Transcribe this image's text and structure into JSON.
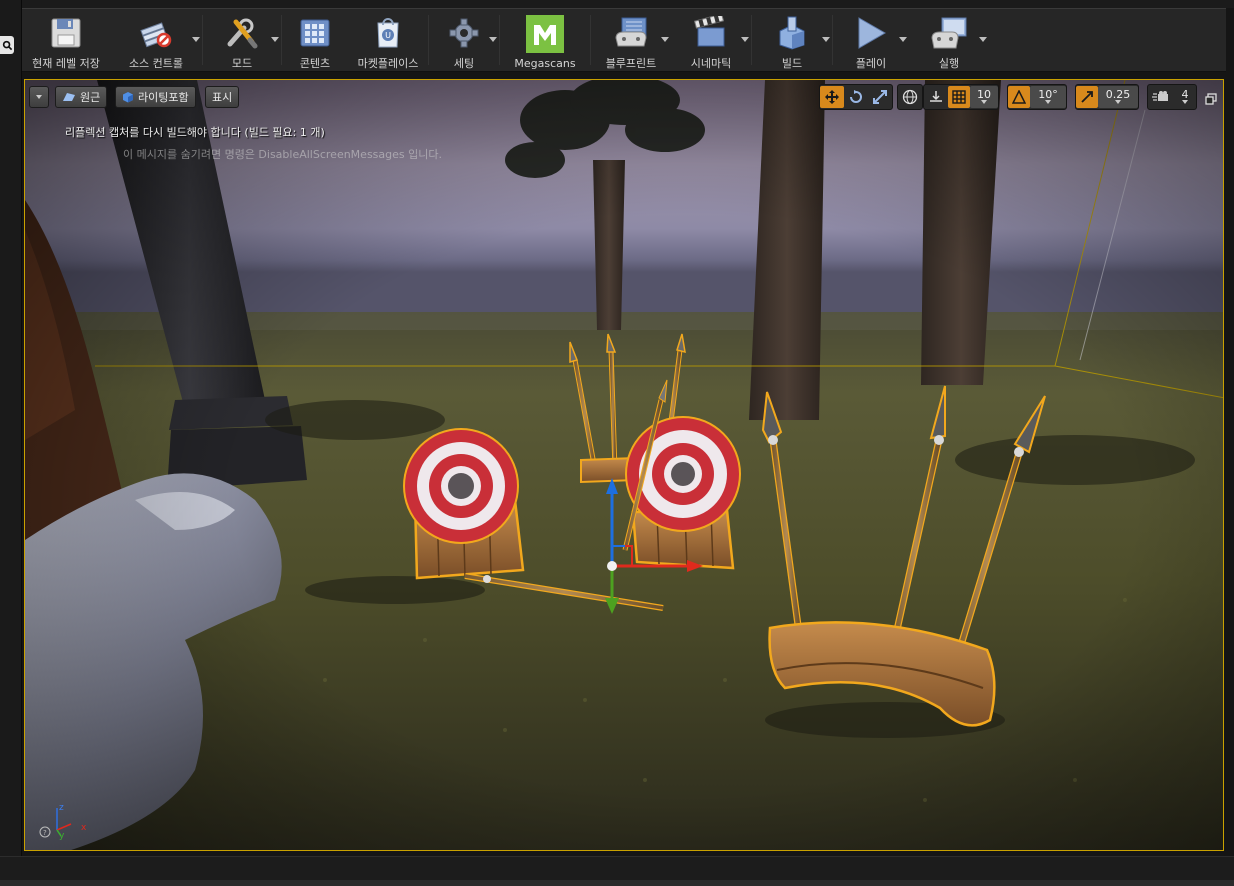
{
  "toolbar": {
    "items": [
      {
        "label": "현재 레벨 저장",
        "icon": "save-icon",
        "dropdown": false
      },
      {
        "label": "소스 컨트롤",
        "icon": "source-control-icon",
        "dropdown": true
      },
      {
        "label": "모드",
        "icon": "modes-icon",
        "dropdown": true
      },
      {
        "label": "콘텐츠",
        "icon": "content-icon",
        "dropdown": false
      },
      {
        "label": "마켓플레이스",
        "icon": "marketplace-icon",
        "dropdown": false
      },
      {
        "label": "세팅",
        "icon": "settings-gear-icon",
        "dropdown": true
      },
      {
        "label": "Megascans",
        "icon": "megascans-icon",
        "dropdown": false
      },
      {
        "label": "블루프린트",
        "icon": "blueprint-icon",
        "dropdown": true
      },
      {
        "label": "시네마틱",
        "icon": "cinematics-icon",
        "dropdown": true
      },
      {
        "label": "빌드",
        "icon": "build-icon",
        "dropdown": true
      },
      {
        "label": "플레이",
        "icon": "play-icon",
        "dropdown": true
      },
      {
        "label": "실행",
        "icon": "launch-icon",
        "dropdown": true
      }
    ]
  },
  "viewport": {
    "perspective_label": "원근",
    "lighting_label": "라이팅포함",
    "show_label": "표시",
    "grid_snap_value": "10",
    "rotation_snap_value": "10°",
    "scale_snap_value": "0.25",
    "camera_speed_value": "4",
    "message_1": "리플렉션 캡처를 다시 빌드해야 합니다 (빌드 필요: 1 개)",
    "message_2": "이 메시지를 숨기려면 명령은 DisableAllScreenMessages 입니다.",
    "axis_x": "x",
    "axis_y": "y",
    "axis_z": "z"
  },
  "colors": {
    "accent": "#d8891c",
    "selection_outline": "#f2a81d",
    "viewport_border": "#c9a100"
  }
}
